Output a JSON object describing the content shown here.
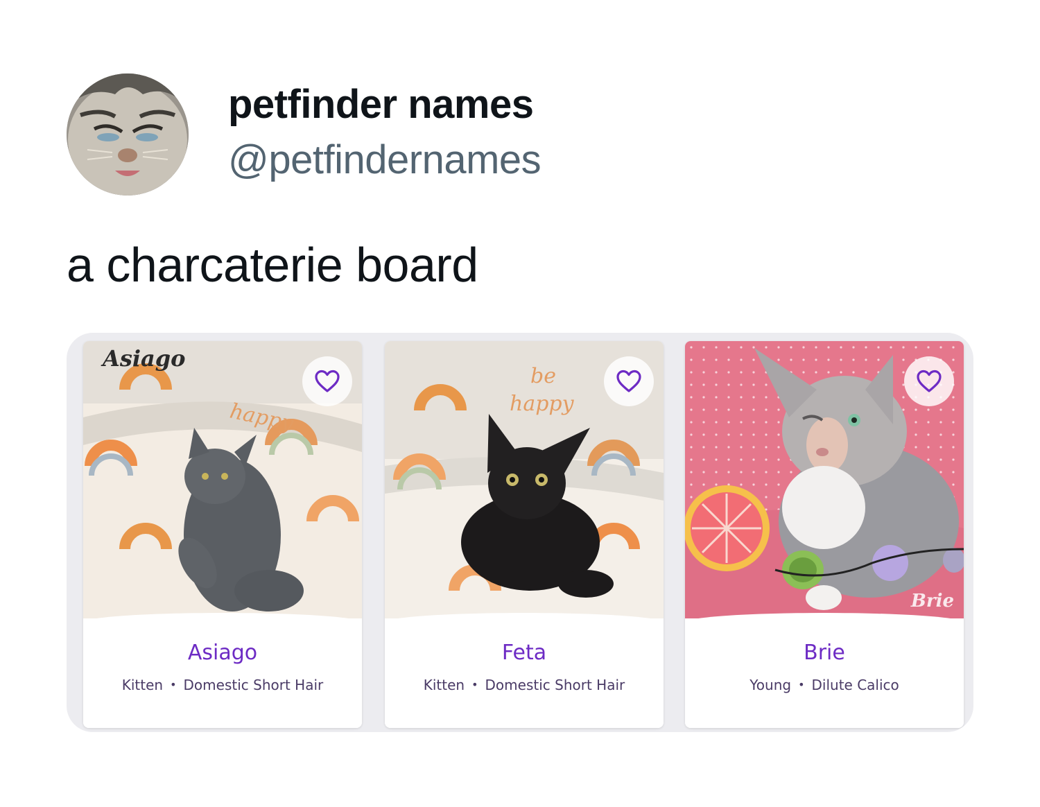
{
  "tweet": {
    "display_name": "petfinder names",
    "handle": "@petfindernames",
    "text": "a charcaterie board",
    "avatar_icon": "kitten-avatar"
  },
  "cards": [
    {
      "name": "Asiago",
      "age": "Kitten",
      "breed": "Domestic Short Hair",
      "photo_caption": "Asiago",
      "favorite_icon": "heart-outline-icon"
    },
    {
      "name": "Feta",
      "age": "Kitten",
      "breed": "Domestic Short Hair",
      "favorite_icon": "heart-outline-icon"
    },
    {
      "name": "Brie",
      "age": "Young",
      "breed": "Dilute Calico",
      "photo_caption": "Brie",
      "favorite_icon": "heart-outline-icon"
    }
  ],
  "colors": {
    "pet_name": "#6d2bc4",
    "heart": "#6d2bc4",
    "handle": "#536471"
  }
}
